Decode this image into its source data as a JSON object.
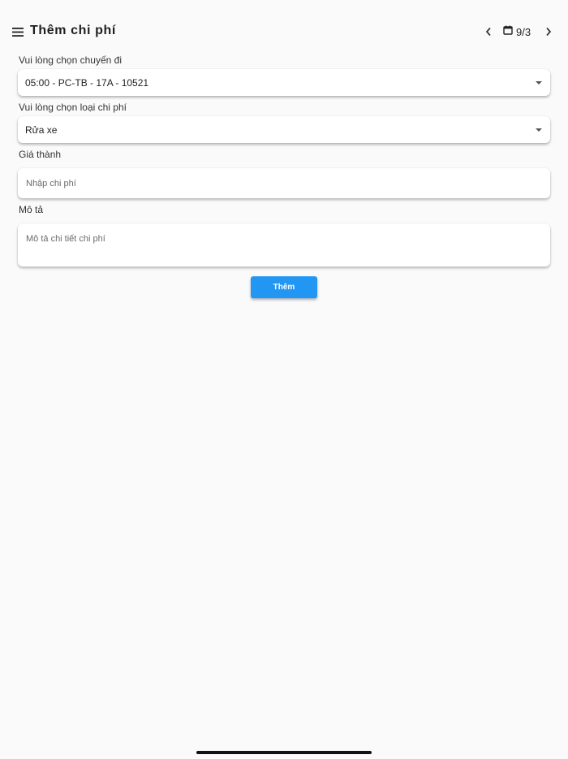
{
  "header": {
    "title": "Thêm chi phí",
    "date": "9/3",
    "icons": {
      "menu": "menu-icon",
      "prev": "chevron-left-icon",
      "calendar": "calendar-icon",
      "next": "chevron-right-icon"
    }
  },
  "form": {
    "trip": {
      "label": "Vui lòng chọn chuyến đi",
      "selected": "05:00 - PC-TB - 17A - 10521"
    },
    "expense_type": {
      "label": "Vui lòng chọn loại chi phí",
      "selected": "Rửa xe"
    },
    "price": {
      "label": "Giá thành",
      "placeholder": "Nhập chi phí",
      "value": ""
    },
    "description": {
      "label": "Mô tả",
      "placeholder": "Mô tả chi tiết chi phí",
      "value": ""
    },
    "submit_label": "Thêm"
  },
  "colors": {
    "accent": "#2196f3",
    "background": "#fbfafb",
    "card": "#ffffff"
  }
}
